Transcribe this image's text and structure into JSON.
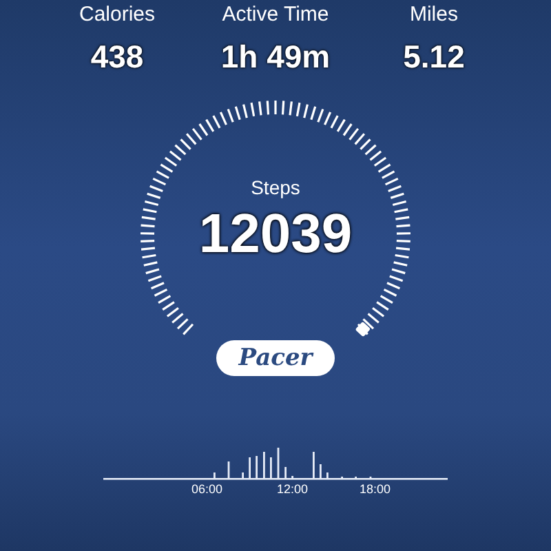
{
  "stats": [
    {
      "label": "Calories",
      "value": "438"
    },
    {
      "label": "Active Time",
      "value": "1h 49m"
    },
    {
      "label": "Miles",
      "value": "5.12"
    }
  ],
  "gauge": {
    "label": "Steps",
    "value": "12039"
  },
  "brand": "Pacer",
  "timeline": {
    "ticks": [
      "06:00",
      "12:00",
      "18:00"
    ]
  }
}
